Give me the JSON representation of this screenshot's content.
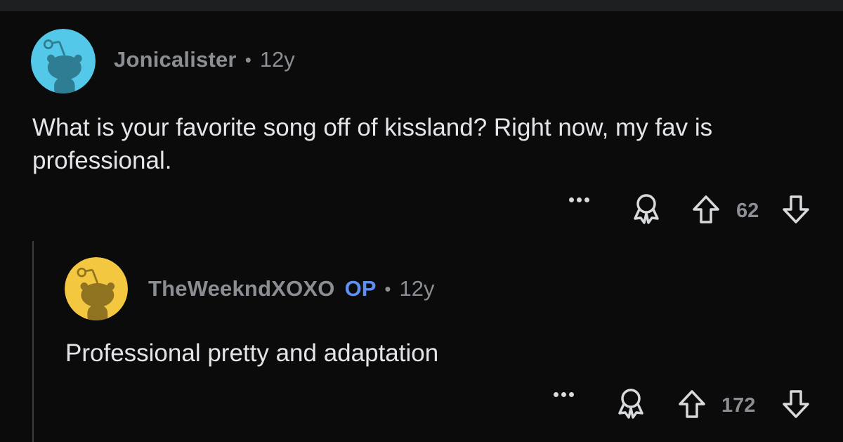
{
  "comments": [
    {
      "username": "Jonicalister",
      "separator": "•",
      "age": "12y",
      "body": "What is your favorite song off of kissland? Right now, my fav is professional.",
      "score": "62",
      "avatar_color": "#54c8e8",
      "avatar_icon": "reddit-snoo-avatar",
      "more_icon": "more-options-icon",
      "award_icon": "award-icon",
      "upvote_icon": "upvote-arrow-icon",
      "downvote_icon": "downvote-arrow-icon"
    },
    {
      "username": "TheWeekndXOXO",
      "op_badge": "OP",
      "separator": "•",
      "age": "12y",
      "body": "Professional pretty and adaptation",
      "score": "172",
      "avatar_color": "#f3c73f",
      "avatar_icon": "reddit-snoo-avatar",
      "more_icon": "more-options-icon",
      "award_icon": "award-icon",
      "upvote_icon": "upvote-arrow-icon",
      "downvote_icon": "downvote-arrow-icon"
    }
  ],
  "colors": {
    "background": "#0b0b0c",
    "muted_text": "#8b8f94",
    "body_text": "#e3e5e8",
    "op_badge": "#5f8ff0",
    "thread_line": "#3a3b3e"
  }
}
